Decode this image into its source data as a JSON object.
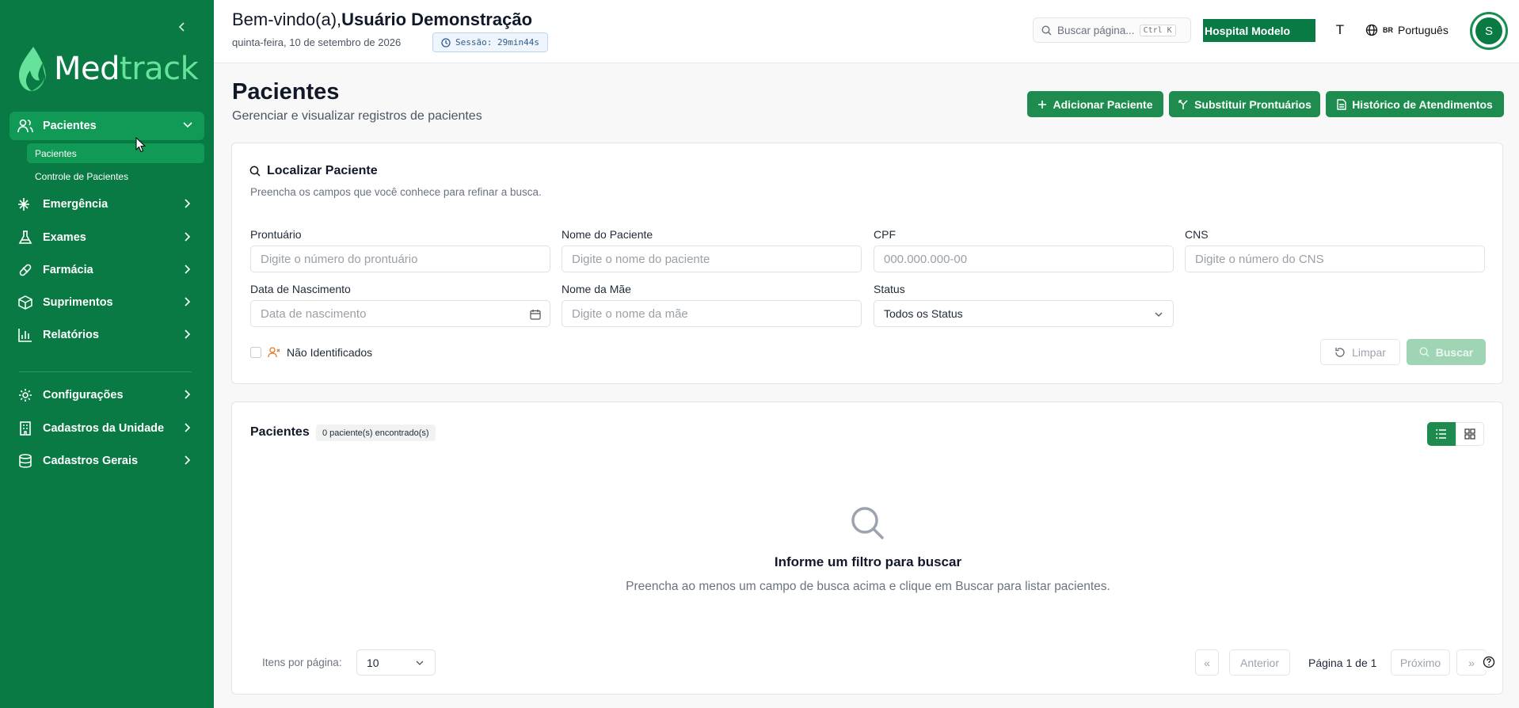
{
  "brand": {
    "name_part1": "Med",
    "name_part2": "track"
  },
  "sidebar": {
    "items": [
      {
        "label": "Pacientes",
        "icon": "users-icon",
        "active": true,
        "expanded": true
      },
      {
        "label": "Emergência",
        "icon": "ambulance-icon"
      },
      {
        "label": "Exames",
        "icon": "flask-icon"
      },
      {
        "label": "Farmácia",
        "icon": "pill-icon"
      },
      {
        "label": "Suprimentos",
        "icon": "box-icon"
      },
      {
        "label": "Relatórios",
        "icon": "bar-chart-icon"
      },
      {
        "label": "Configurações",
        "icon": "gear-icon"
      },
      {
        "label": "Cadastros da Unidade",
        "icon": "building-icon"
      },
      {
        "label": "Cadastros Gerais",
        "icon": "database-icon"
      }
    ],
    "sub_items": [
      {
        "label": "Pacientes",
        "active": true
      },
      {
        "label": "Controle de Pacientes"
      }
    ]
  },
  "header": {
    "welcome_prefix": "Bem-vindo(a),",
    "user_name": "Usuário Demonstração",
    "date": "quinta-feira, 10 de setembro de 2026",
    "session": "Sessão: 29min44s",
    "search_placeholder": "Buscar página...",
    "search_shortcut": "Ctrl K",
    "hospital": "Hospital Modelo",
    "font_toggle": "T",
    "lang_flag": "BR",
    "language": "Português",
    "avatar_initial": "S"
  },
  "page": {
    "title": "Pacientes",
    "subtitle": "Gerenciar e visualizar registros de pacientes",
    "actions": {
      "add": "Adicionar Paciente",
      "replace": "Substituir Prontuários",
      "history": "Histórico de Atendimentos"
    }
  },
  "filter": {
    "title": "Localizar Paciente",
    "description": "Preencha os campos que você conhece para refinar a busca.",
    "fields": {
      "prontuario": {
        "label": "Prontuário",
        "placeholder": "Digite o número do prontuário"
      },
      "nome": {
        "label": "Nome do Paciente",
        "placeholder": "Digite o nome do paciente"
      },
      "cpf": {
        "label": "CPF",
        "placeholder": "000.000.000-00"
      },
      "cns": {
        "label": "CNS",
        "placeholder": "Digite o número do CNS"
      },
      "nascimento": {
        "label": "Data de Nascimento",
        "placeholder": "Data de nascimento"
      },
      "mae": {
        "label": "Nome da Mãe",
        "placeholder": "Digite o nome da mãe"
      },
      "status": {
        "label": "Status",
        "value": "Todos os Status"
      }
    },
    "unidentified_label": "Não Identificados",
    "clear_label": "Limpar",
    "search_label": "Buscar"
  },
  "results": {
    "title": "Pacientes",
    "count_badge": "0 paciente(s) encontrado(s)",
    "empty_title": "Informe um filtro para buscar",
    "empty_desc": "Preencha ao menos um campo de busca acima e clique em Buscar para listar pacientes.",
    "per_page_label": "Itens por página:",
    "per_page_value": "10",
    "first": "«",
    "prev": "Anterior",
    "page_info": "Página 1 de 1",
    "next": "Próximo",
    "last": "»"
  },
  "colors": {
    "sidebar_bg": "#0a7a44",
    "accent": "#1e8c4e",
    "accent_light": "#66e39a"
  }
}
